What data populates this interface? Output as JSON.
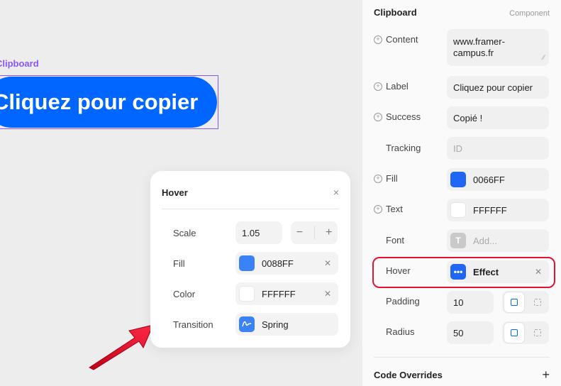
{
  "canvas": {
    "frame_label": "Clipboard",
    "button_text": "Cliquez pour copier"
  },
  "popover": {
    "title": "Hover",
    "close_icon": "×",
    "rows": {
      "scale": {
        "label": "Scale",
        "value": "1.05",
        "minus": "−",
        "plus": "+"
      },
      "fill": {
        "label": "Fill",
        "value": "0088FF",
        "color": "#3b82f6"
      },
      "color": {
        "label": "Color",
        "value": "FFFFFF",
        "color": "#ffffff"
      },
      "transition": {
        "label": "Transition",
        "value": "Spring"
      }
    }
  },
  "panel": {
    "title": "Clipboard",
    "subtitle": "Component",
    "content": {
      "label": "Content",
      "value": "www.framer-campus.fr"
    },
    "label_row": {
      "label": "Label",
      "value": "Cliquez pour copier"
    },
    "success": {
      "label": "Success",
      "value": "Copié !"
    },
    "tracking": {
      "label": "Tracking",
      "placeholder": "ID"
    },
    "fill": {
      "label": "Fill",
      "value": "0066FF",
      "color": "#1f66f2"
    },
    "text": {
      "label": "Text",
      "value": "FFFFFF",
      "color": "#ffffff"
    },
    "font": {
      "label": "Font",
      "placeholder": "Add...",
      "icon_letter": "T"
    },
    "hover": {
      "label": "Hover",
      "value": "Effect"
    },
    "padding": {
      "label": "Padding",
      "value": "10"
    },
    "radius": {
      "label": "Radius",
      "value": "50"
    },
    "code_overrides": {
      "label": "Code Overrides",
      "add": "+"
    }
  },
  "colors": {
    "accent": "#0066ff",
    "selection": "#8855ff",
    "highlight": "#e0142d"
  },
  "annotation": {
    "arrow": "red-arrow"
  }
}
